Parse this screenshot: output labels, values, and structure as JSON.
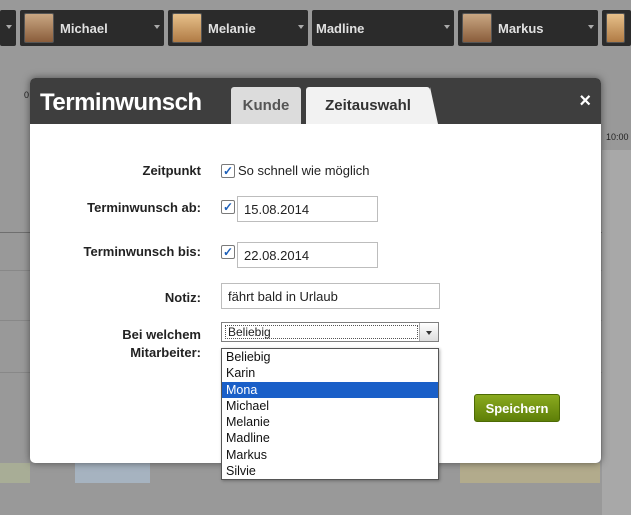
{
  "background": {
    "staff": [
      {
        "name": "",
        "avatar": "none"
      },
      {
        "name": "Michael",
        "avatar": "male-avatar-icon"
      },
      {
        "name": "Melanie",
        "avatar": "female-avatar-icon"
      },
      {
        "name": "Madline",
        "avatar": "none"
      },
      {
        "name": "Markus",
        "avatar": "male-avatar-icon"
      },
      {
        "name": "",
        "avatar": "female-avatar-icon"
      }
    ],
    "time_left": "0",
    "time_right": "10:00"
  },
  "modal": {
    "title": "Terminwunsch",
    "tabs": [
      {
        "label": "Kunde",
        "active": false
      },
      {
        "label": "Zeitauswahl",
        "active": true
      }
    ],
    "close_icon": "×"
  },
  "form": {
    "zeitpunkt": {
      "label": "Zeitpunkt",
      "checked": true,
      "checkbox_label": "So schnell wie möglich"
    },
    "ab": {
      "label": "Terminwunsch ab:",
      "checked": true,
      "value": "15.08.2014"
    },
    "bis": {
      "label": "Terminwunsch bis:",
      "checked": true,
      "value": "22.08.2014"
    },
    "notiz": {
      "label": "Notiz:",
      "value": "fährt bald in Urlaub"
    },
    "mitarbeiter": {
      "label_line1": "Bei welchem",
      "label_line2": "Mitarbeiter:",
      "selected": "Beliebig",
      "options": [
        "Beliebig",
        "Karin",
        "Mona",
        "Michael",
        "Melanie",
        "Madline",
        "Markus",
        "Silvie"
      ],
      "highlighted": "Mona"
    },
    "save_label": "Speichern"
  },
  "colors": {
    "header_bg": "#3e3e3e",
    "highlight": "#1a5fc8",
    "save_button": "#6f8f12"
  }
}
